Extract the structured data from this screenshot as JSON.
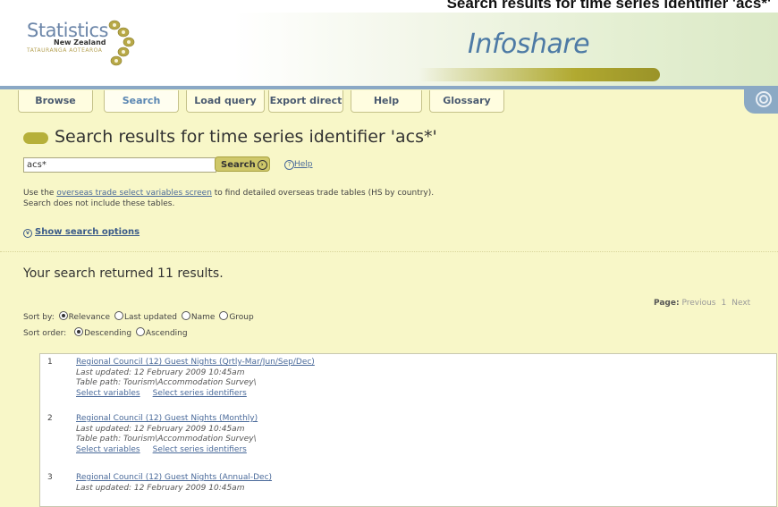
{
  "caption": "Search results for time series identifier 'acs*'",
  "header": {
    "logo_line1": "Statistics",
    "logo_line2": "New Zealand",
    "logo_line3": "TATAURANGA AOTEAROA",
    "brand": "Infoshare"
  },
  "tabs": [
    {
      "label": "Browse"
    },
    {
      "label": "Search"
    },
    {
      "label": "Load query"
    },
    {
      "label": "Export direct"
    },
    {
      "label": "Help"
    },
    {
      "label": "Glossary"
    }
  ],
  "page_title": "Search results for time series identifier 'acs*'",
  "search": {
    "value": "acs*",
    "button_label": "Search",
    "help_label": "Help"
  },
  "info": {
    "line1_pre": "Use the ",
    "line1_link": "overseas trade select variables screen",
    "line1_post": " to find detailed overseas trade tables (HS by country).",
    "line2": "Search does not include these tables."
  },
  "show_options_label": "Show search options",
  "results_text": "Your search returned 11 results.",
  "pager": {
    "label": "Page:",
    "previous": "Previous",
    "current": "1",
    "next": "Next"
  },
  "sort_by": {
    "label": "Sort by:",
    "options": [
      "Relevance",
      "Last updated",
      "Name",
      "Group"
    ],
    "selected": "Relevance"
  },
  "sort_order": {
    "label": "Sort order:",
    "options": [
      "Descending",
      "Ascending"
    ],
    "selected": "Descending"
  },
  "items": [
    {
      "number": "1",
      "title": "Regional Council (12) Guest Nights (Qrtly-Mar/Jun/Sep/Dec)",
      "updated": "Last updated: 12 February 2009 10:45am",
      "path": "Table path: Tourism\\Accommodation Survey\\",
      "action1": "Select variables",
      "action2": "Select series identifiers"
    },
    {
      "number": "2",
      "title": "Regional Council (12) Guest Nights (Monthly)",
      "updated": "Last updated: 12 February 2009 10:45am",
      "path": "Table path: Tourism\\Accommodation Survey\\",
      "action1": "Select variables",
      "action2": "Select series identifiers"
    },
    {
      "number": "3",
      "title": "Regional Council (12) Guest Nights (Annual-Dec)",
      "updated": "Last updated: 12 February 2009 10:45am",
      "path": "",
      "action1": "",
      "action2": ""
    }
  ]
}
